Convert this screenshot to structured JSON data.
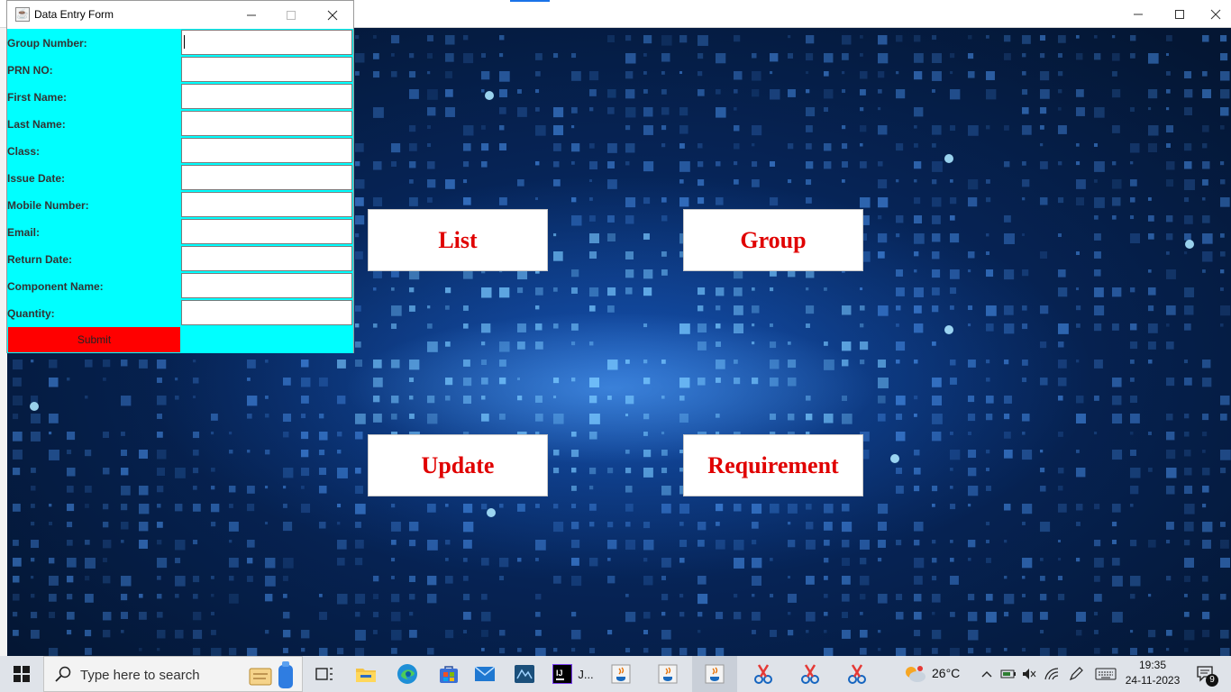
{
  "dialog": {
    "title": "Data Entry Form",
    "fields": [
      {
        "label": "Group Number:",
        "value": ""
      },
      {
        "label": "PRN NO:",
        "value": ""
      },
      {
        "label": "First Name:",
        "value": ""
      },
      {
        "label": "Last Name:",
        "value": ""
      },
      {
        "label": "Class:",
        "value": ""
      },
      {
        "label": "Issue Date:",
        "value": ""
      },
      {
        "label": "Mobile Number:",
        "value": ""
      },
      {
        "label": "Email:",
        "value": ""
      },
      {
        "label": "Return Date:",
        "value": ""
      },
      {
        "label": "Component Name:",
        "value": ""
      },
      {
        "label": "Quantity:",
        "value": ""
      }
    ],
    "submit_label": "Submit",
    "colors": {
      "background": "#00ffff",
      "submit": "#ff0000"
    }
  },
  "main": {
    "buttons": {
      "list": "List",
      "group": "Group",
      "update": "Update",
      "requirement": "Requirement"
    },
    "button_text_color": "#e00000"
  },
  "taskbar": {
    "search_placeholder": "Type here to search",
    "intellij_label": "J...",
    "weather": "26°C",
    "time": "19:35",
    "date": "24-11-2023",
    "notification_count": "9",
    "icons": [
      "windows-start-icon",
      "search-icon",
      "task-view-icon",
      "file-explorer-icon",
      "edge-icon",
      "store-icon",
      "mail-icon",
      "mysql-workbench-icon",
      "intellij-icon",
      "java-app-icon",
      "java-app-icon",
      "java-app-icon",
      "snipping-tool-icon",
      "snipping-tool-icon",
      "snipping-tool-icon"
    ]
  }
}
